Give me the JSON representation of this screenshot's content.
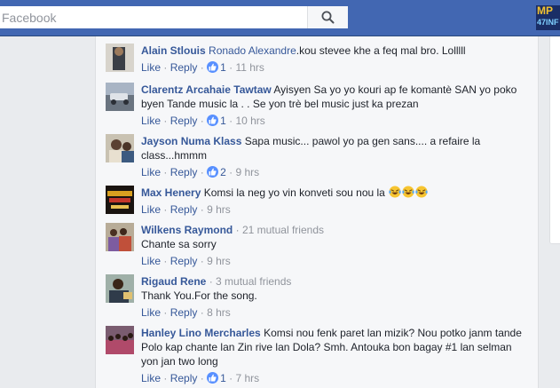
{
  "search": {
    "placeholder": "Facebook"
  },
  "corner_app": {
    "line1": "MP",
    "line2": "47INF"
  },
  "actions": {
    "like": "Like",
    "reply": "Reply",
    "sep": "·"
  },
  "comments": [
    {
      "author": "Alain Stlouis",
      "tag": "Ronado Alexandre",
      "text": ".kou stevee khe a feq mal bro. Lolllll",
      "likes": "1",
      "time": "11 hrs"
    },
    {
      "author": "Clarentz Arcahaie Tawtaw",
      "text": "Ayisyen Sa yo yo kouri ap fe komantè SAN yo poko byen Tande music la . . Se yon trè bel music just ka prezan",
      "likes": "1",
      "time": "10 hrs"
    },
    {
      "author": "Jayson Numa Klass",
      "text": "Sapa music... pawol yo pa gen sans.... a refaire la class...hmmm",
      "likes": "2",
      "time": "9 hrs"
    },
    {
      "author": "Max Henery",
      "text": "Komsi la neg yo vin konveti sou nou la",
      "time": "9 hrs",
      "emoji": [
        "laughing-tears",
        "laughing-tears",
        "laughing-tears"
      ]
    },
    {
      "author": "Wilkens Raymond",
      "note": "21 mutual friends",
      "text": "Chante sa sorry",
      "time": "9 hrs"
    },
    {
      "author": "Rigaud Rene",
      "note": "3 mutual friends",
      "text": "Thank You.For the song.",
      "time": "8 hrs"
    },
    {
      "author": "Hanley Lino Mercharles",
      "text": "Komsi nou fenk paret lan mizik? Nou potko janm tande Polo kap chante lan Zin rive lan Dola? Smh. Antouka bon bagay #1 lan selman yon jan two long",
      "likes": "1",
      "time": "7 hrs"
    }
  ],
  "colors": {
    "brand_bar": "#4267b2",
    "link": "#365899",
    "meta": "#90949c",
    "like_bubble": "#5890ff"
  }
}
